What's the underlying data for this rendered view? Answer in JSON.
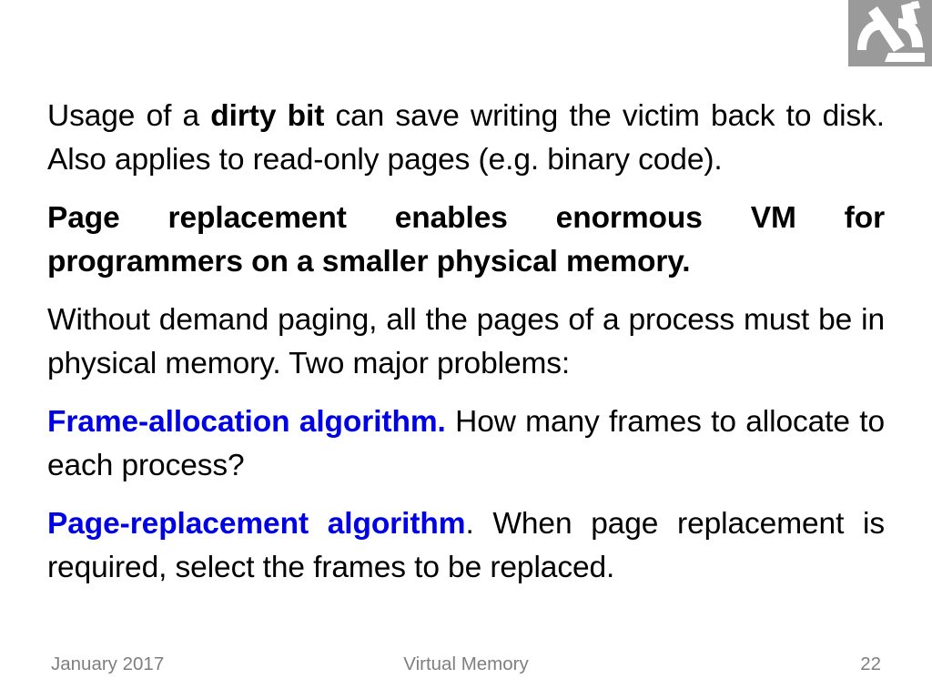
{
  "slide": {
    "number": "22",
    "deck_title": "Virtual Memory",
    "date": "January 2017",
    "background_color": "#ffffff",
    "accent_color": "#0000e6",
    "footer_color": "#7f7f7f",
    "logo": {
      "icon": "microscope-icon",
      "background_color": "#9a9a9a",
      "glyph_color": "#ffffff"
    }
  },
  "body": {
    "paragraphs": [
      {
        "id": "dirty-bit",
        "style": "normal",
        "runs": [
          {
            "text": "Usage of a ",
            "style": "normal"
          },
          {
            "text": "dirty bit",
            "style": "bold"
          },
          {
            "text": " can save writing the victim back to disk. Also applies to read-only pages (e.g. binary code).",
            "style": "normal"
          }
        ],
        "plain": "Usage of a dirty bit can save writing the victim back to disk. Also applies to read-only pages (e.g. binary code)."
      },
      {
        "id": "page-replacement-benefit",
        "style": "bold",
        "runs": [
          {
            "text": "Page replacement enables enormous VM for programmers on a smaller physical memory.",
            "style": "bold"
          }
        ],
        "plain": "Page replacement enables enormous VM for programmers on a smaller physical memory."
      },
      {
        "id": "without-demand-paging",
        "style": "normal",
        "runs": [
          {
            "text": "Without demand paging, all the pages of a process must be in physical memory. Two major problems:",
            "style": "normal"
          }
        ],
        "plain": "Without demand paging, all the pages of a process must be in physical memory. Two major problems:"
      },
      {
        "id": "frame-allocation-algorithm",
        "style": "normal",
        "runs": [
          {
            "text": "Frame-allocation algorithm.",
            "style": "blue-bold"
          },
          {
            "text": " How many frames to allocate to each process?",
            "style": "normal"
          }
        ],
        "lead_in": "Frame-allocation algorithm.",
        "rest": " How many frames to allocate to each process?",
        "plain": "Frame-allocation algorithm. How many frames to allocate to each process?"
      },
      {
        "id": "page-replacement-algorithm",
        "style": "normal",
        "runs": [
          {
            "text": "Page-replacement algorithm",
            "style": "blue-bold"
          },
          {
            "text": ". When page replacement is required, select the frames to be replaced.",
            "style": "normal"
          }
        ],
        "lead_in": "Page-replacement algorithm",
        "rest": ". When page replacement is required, select the frames to be replaced.",
        "plain": "Page-replacement algorithm. When page replacement is required, select the frames to be replaced."
      }
    ]
  },
  "footer": {
    "date": "January 2017",
    "title": "Virtual Memory",
    "page": "22"
  },
  "para1": {
    "lead": "Usage of a ",
    "bold": "dirty bit",
    "tail": " can save writing the victim back to disk. Also applies to read-only pages (e.g. binary code)."
  },
  "para2": {
    "text": "Page replacement enables enormous VM for programmers on a smaller physical memory."
  },
  "para3": {
    "text": "Without demand paging, all the pages of a process must be in physical memory. Two major problems:"
  },
  "para4": {
    "lead_in": "Frame-allocation algorithm.",
    "rest": " How many frames to allocate to each process?"
  },
  "para5": {
    "lead_in": "Page-replacement algorithm",
    "rest": ". When page replacement is required, select the frames to be replaced."
  }
}
